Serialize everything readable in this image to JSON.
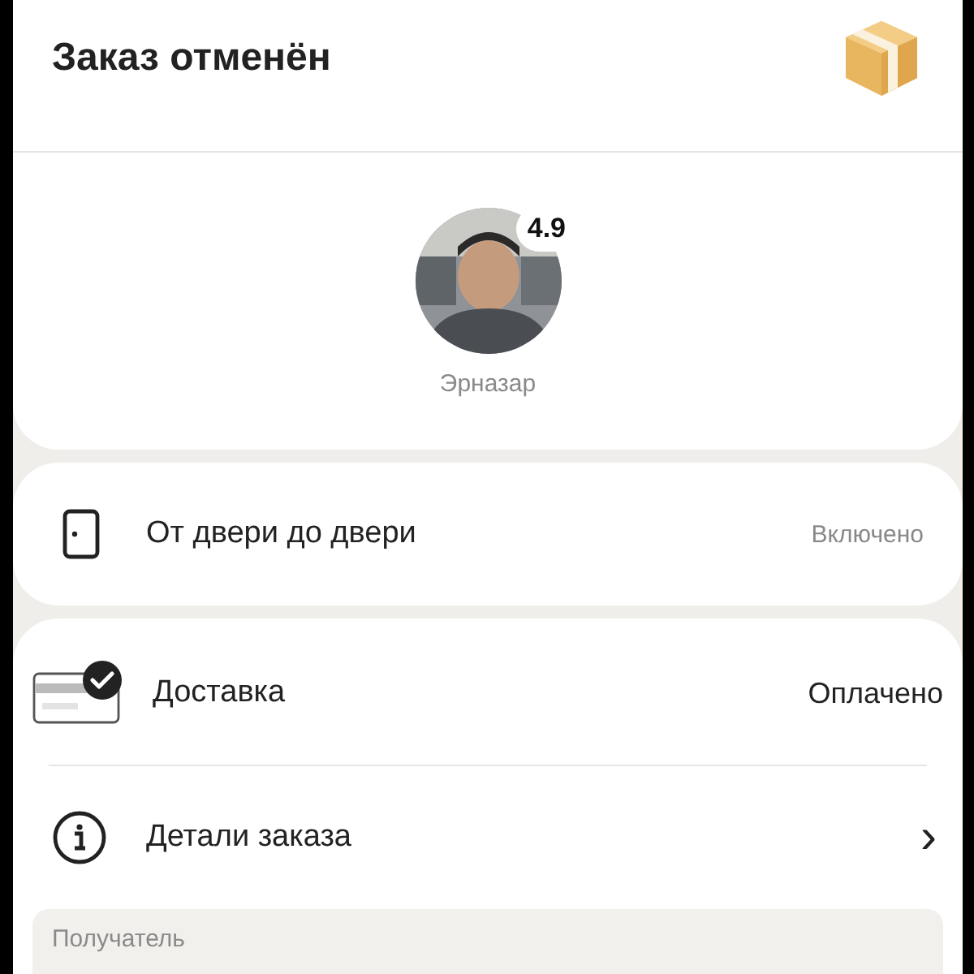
{
  "header": {
    "title": "Заказ отменён"
  },
  "courier": {
    "rating": "4.9",
    "name": "Эрназар"
  },
  "option": {
    "label": "От двери до двери",
    "value": "Включено"
  },
  "rows": [
    {
      "kind": "payment",
      "label": "Доставка",
      "value": "Оплачено"
    },
    {
      "kind": "details",
      "label": "Детали заказа",
      "chevron": "›"
    }
  ],
  "recipient": {
    "label": "Получатель"
  }
}
